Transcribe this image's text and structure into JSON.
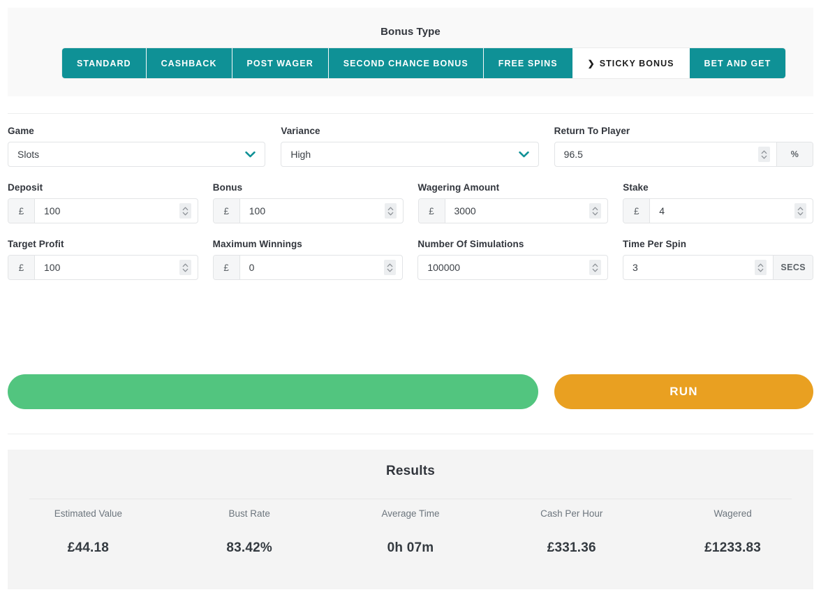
{
  "bonus_type": {
    "title": "Bonus Type",
    "tabs": [
      {
        "label": "STANDARD",
        "active": false
      },
      {
        "label": "CASHBACK",
        "active": false
      },
      {
        "label": "POST WAGER",
        "active": false
      },
      {
        "label": "SECOND CHANCE BONUS",
        "active": false
      },
      {
        "label": "FREE SPINS",
        "active": false
      },
      {
        "label": "STICKY BONUS",
        "active": true
      },
      {
        "label": "BET AND GET",
        "active": false
      }
    ],
    "active_marker": "❯",
    "tab_color": "#0f9196",
    "active_tab_bg": "#ffffff"
  },
  "form": {
    "game": {
      "label": "Game",
      "value": "Slots"
    },
    "variance": {
      "label": "Variance",
      "value": "High"
    },
    "return_to_player": {
      "label": "Return To Player",
      "value": "96.5",
      "suffix": "%"
    },
    "deposit": {
      "label": "Deposit",
      "prefix": "£",
      "value": "100"
    },
    "bonus": {
      "label": "Bonus",
      "prefix": "£",
      "value": "100"
    },
    "wagering_amount": {
      "label": "Wagering Amount",
      "prefix": "£",
      "value": "3000"
    },
    "stake": {
      "label": "Stake",
      "prefix": "£",
      "value": "4"
    },
    "target_profit": {
      "label": "Target Profit",
      "prefix": "£",
      "value": "100"
    },
    "maximum_winnings": {
      "label": "Maximum Winnings",
      "prefix": "£",
      "value": "0"
    },
    "number_of_simulations": {
      "label": "Number Of Simulations",
      "value": "100000"
    },
    "time_per_spin": {
      "label": "Time Per Spin",
      "value": "3",
      "suffix": "SECS"
    }
  },
  "actions": {
    "secondary_label": "",
    "secondary_color": "#52c57f",
    "run_label": "RUN",
    "run_color": "#e9a021"
  },
  "results": {
    "title": "Results",
    "columns": [
      {
        "label": "Estimated Value",
        "value": "£44.18"
      },
      {
        "label": "Bust Rate",
        "value": "83.42%"
      },
      {
        "label": "Average Time",
        "value": "0h 07m"
      },
      {
        "label": "Cash Per Hour",
        "value": "£331.36"
      },
      {
        "label": "Wagered",
        "value": "£1233.83"
      }
    ]
  }
}
